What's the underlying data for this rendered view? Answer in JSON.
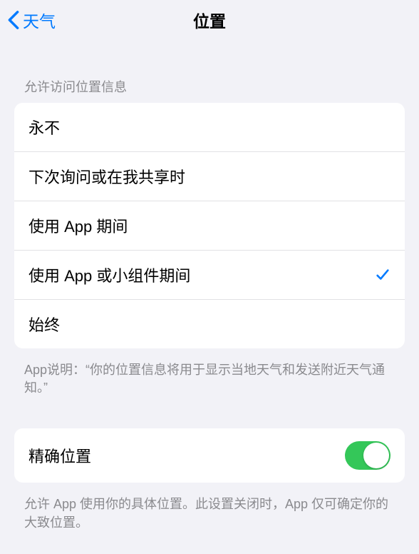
{
  "nav": {
    "back_label": "天气",
    "title": "位置"
  },
  "section1": {
    "header": "允许访问位置信息",
    "options": [
      {
        "label": "永不",
        "selected": false
      },
      {
        "label": "下次询问或在我共享时",
        "selected": false
      },
      {
        "label": "使用 App 期间",
        "selected": false
      },
      {
        "label": "使用 App 或小组件期间",
        "selected": true
      },
      {
        "label": "始终",
        "selected": false
      }
    ],
    "footer": "App说明：“你的位置信息将用于显示当地天气和发送附近天气通知。”"
  },
  "section2": {
    "precise_label": "精确位置",
    "precise_enabled": true,
    "footer": "允许 App 使用你的具体位置。此设置关闭时，App 仅可确定你的大致位置。"
  }
}
